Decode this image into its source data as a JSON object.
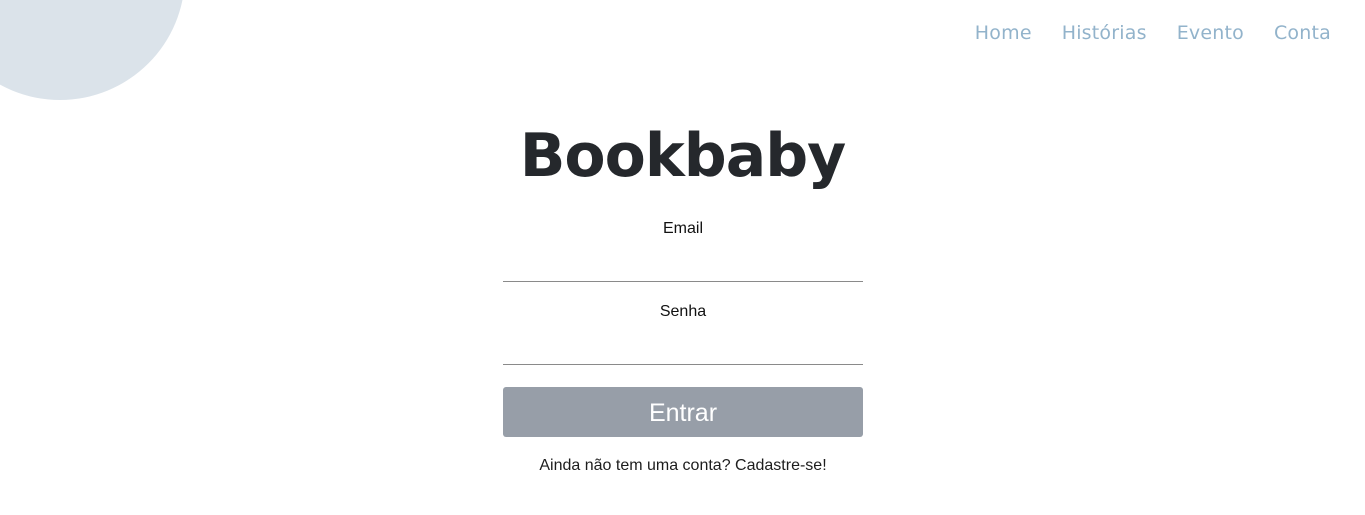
{
  "nav": {
    "items": [
      {
        "label": "Home"
      },
      {
        "label": "Histórias"
      },
      {
        "label": "Evento"
      },
      {
        "label": "Conta"
      }
    ]
  },
  "brand": {
    "title": "Bookbaby"
  },
  "form": {
    "email_label": "Email",
    "email_value": "",
    "password_label": "Senha",
    "password_value": "",
    "submit_label": "Entrar",
    "signup_prompt": "Ainda não tem uma conta?",
    "signup_link": "Cadastre-se!"
  },
  "colors": {
    "nav_link": "#92b3cb",
    "decor_circle": "#dbe3ea",
    "button_bg": "#979ea8",
    "brand_text": "#25282c"
  }
}
